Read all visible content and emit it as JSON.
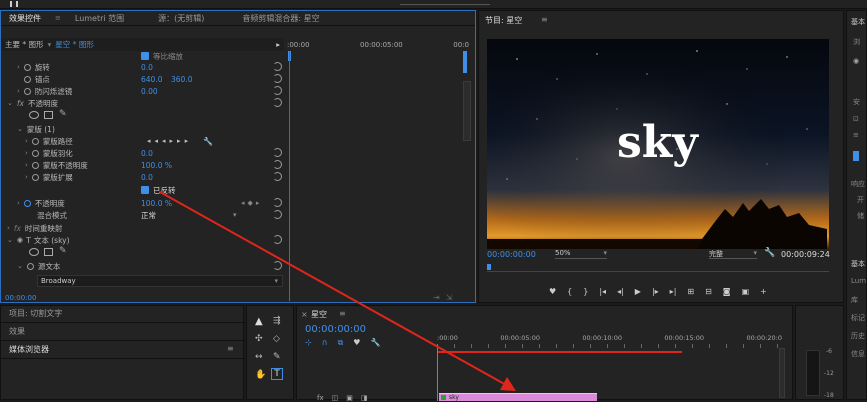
{
  "effect_controls": {
    "tabs": [
      "效果控件",
      "Lumetri 范围",
      "源：(无剪辑)",
      "音频剪辑混合器: 星空"
    ],
    "tab_menu": "≡",
    "clip_master": "主要 * 图形",
    "clip_current": "星空 * 图形",
    "timecode_start": ":00:00",
    "timecode_mid": "00:00:05:00",
    "timecode_end": "00:0",
    "rows": {
      "uniform_scale": "等比缩放",
      "rotation": "旋转",
      "rotation_val": "0.0",
      "anchor": "锚点",
      "anchor_x": "640.0",
      "anchor_y": "360.0",
      "antiflicker": "防闪烁滤镜",
      "antiflicker_val": "0.00",
      "opacity_group": "不透明度",
      "mask": "蒙版 (1)",
      "mask_path": "蒙版路径",
      "mask_feather": "蒙版羽化",
      "mask_feather_val": "0.0",
      "mask_opacity": "蒙版不透明度",
      "mask_opacity_val": "100.0 %",
      "mask_expansion": "蒙版扩展",
      "mask_expansion_val": "0.0",
      "inverted": "已反转",
      "opacity": "不透明度",
      "opacity_val": "100.0 %",
      "blend_mode": "混合模式",
      "blend_mode_val": "正常",
      "time_remap": "时间重映射",
      "text_layer": "文本 (sky)",
      "source_text": "源文本",
      "font": "Broadway"
    },
    "bottom_timecode": "00:00:00"
  },
  "program": {
    "title": "节目: 星空",
    "menu": "≡",
    "overlay_text": "sky",
    "timecode": "00:00:00:00",
    "zoom": "50%",
    "quality": "完整",
    "duration": "00:00:09:24"
  },
  "project": {
    "item_project": "项目: 切割文字",
    "item_effects": "效果",
    "item_media": "媒体浏览器",
    "menu": "≡"
  },
  "timeline": {
    "title": "星空",
    "menu": "≡",
    "timecode": "00:00:00:00",
    "ruler": [
      ":00:00",
      "00:00:05:00",
      "00:00:10:00",
      "00:00:15:00",
      "00:00:20:0"
    ],
    "clip_label": "sky"
  },
  "right_panel": {
    "items": [
      "基本",
      "浏",
      "安",
      "响应",
      "开",
      "储",
      "基本",
      "Lumet",
      "库",
      "标记",
      "历史",
      "信息"
    ]
  },
  "meter": {
    "labels": [
      "-6",
      "-12",
      "-18"
    ]
  },
  "colors": {
    "accent_blue": "#3f8fe6",
    "arrow_red": "#e0251b",
    "clip_pink": "#d98ad9",
    "clip_green": "#2e9d3a"
  }
}
